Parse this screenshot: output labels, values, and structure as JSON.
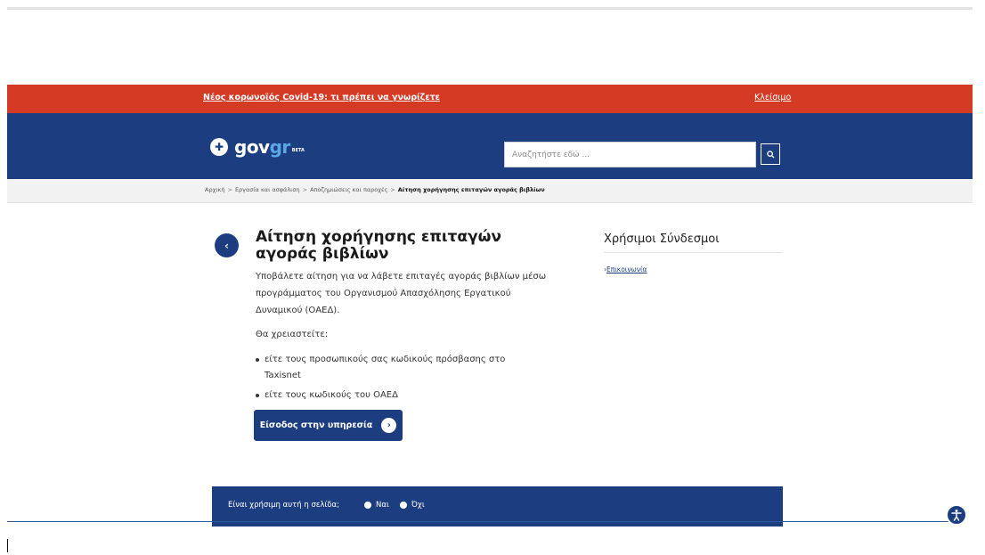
{
  "covid_banner": {
    "link_text": "Νέος κορωνοϊός Covid-19: τι πρέπει να γνωρίζετε",
    "close_text": "Κλείσιμο",
    "background_color": "#d43a24"
  },
  "header": {
    "logo_icon": "greek-emblem-icon",
    "logo_prefix": "gov",
    "logo_suffix": "gr",
    "logo_badge": "BETA",
    "search_placeholder": "Αναζητήστε εδώ ...",
    "search_icon": "search-icon",
    "background_color": "#1c3d80"
  },
  "breadcrumb": {
    "items": [
      "Αρχική",
      "Εργασία και ασφάλιση",
      "Αποζημιώσεις και παροχές"
    ],
    "current": "Αίτηση χορήγησης επιταγών αγοράς βιβλίων",
    "separator": ">"
  },
  "main": {
    "back_icon": "chevron-left-icon",
    "title": "Αίτηση χορήγησης επιταγών αγοράς βιβλίων",
    "intro": "Υποβάλετε αίτηση για να λάβετε επιταγές αγοράς βιβλίων μέσω προγράμματος του Οργανισμού Απασχόλησης Εργατικού Δυναμικού (ΟΑΕΔ).",
    "need_label": "Θα χρειαστείτε:",
    "requirements": [
      "είτε τους προσωπικούς σας κωδικούς πρόσβασης στο Taxisnet",
      "είτε τους κωδικούς του ΟΑΕΔ"
    ],
    "enter_button": "Είσοδος στην υπηρεσία",
    "enter_icon": "arrow-right-circle-icon"
  },
  "sidebar": {
    "title": "Χρήσιμοι Σύνδεσμοι",
    "links": [
      {
        "label": "Επικοινωνία"
      }
    ]
  },
  "feedback": {
    "question": "Είναι χρήσιμη αυτή η σελίδα;",
    "yes": "Ναι",
    "no": "Όχι"
  },
  "accessibility_icon": "accessibility-icon"
}
